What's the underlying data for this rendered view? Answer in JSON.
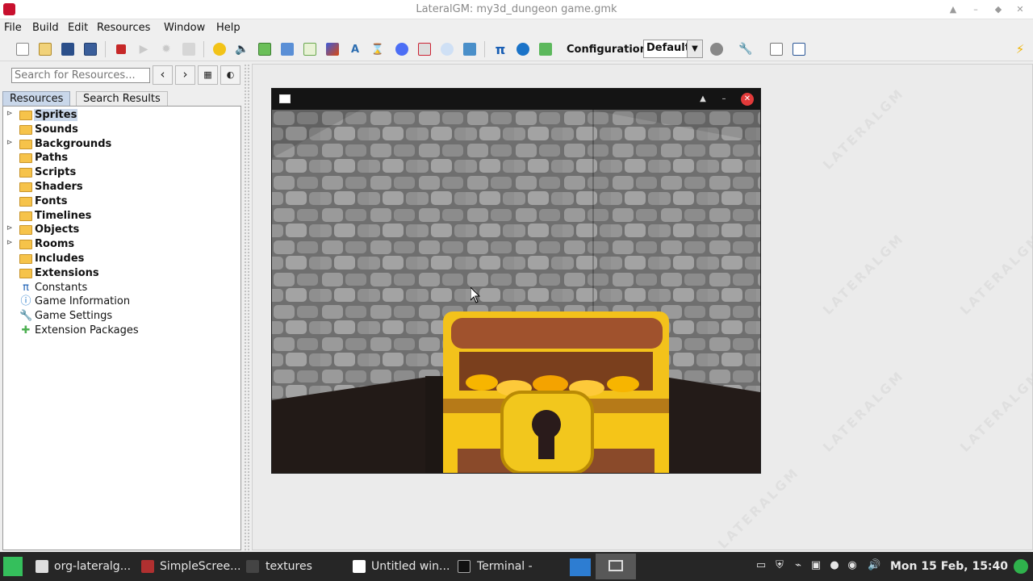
{
  "window": {
    "title": "LateralGM: my3d_dungeon game.gmk"
  },
  "menu": [
    "File",
    "Build",
    "Edit",
    "Resources",
    "Window",
    "Help"
  ],
  "toolbar": {
    "config_label": "Configuration:",
    "config_value": "Default"
  },
  "search": {
    "placeholder": "Search for Resources..."
  },
  "tabs": {
    "resources": "Resources",
    "search_results": "Search Results"
  },
  "tree": [
    {
      "label": "Sprites",
      "kind": "folder",
      "expandable": true,
      "bold": true,
      "selected": true
    },
    {
      "label": "Sounds",
      "kind": "folder",
      "expandable": false,
      "bold": true
    },
    {
      "label": "Backgrounds",
      "kind": "folder",
      "expandable": true,
      "bold": true
    },
    {
      "label": "Paths",
      "kind": "folder",
      "expandable": false,
      "bold": true
    },
    {
      "label": "Scripts",
      "kind": "folder",
      "expandable": false,
      "bold": true
    },
    {
      "label": "Shaders",
      "kind": "folder",
      "expandable": false,
      "bold": true
    },
    {
      "label": "Fonts",
      "kind": "folder",
      "expandable": false,
      "bold": true
    },
    {
      "label": "Timelines",
      "kind": "folder",
      "expandable": false,
      "bold": true
    },
    {
      "label": "Objects",
      "kind": "folder",
      "expandable": true,
      "bold": true
    },
    {
      "label": "Rooms",
      "kind": "folder",
      "expandable": true,
      "bold": true
    },
    {
      "label": "Includes",
      "kind": "folder",
      "expandable": false,
      "bold": true
    },
    {
      "label": "Extensions",
      "kind": "folder",
      "expandable": false,
      "bold": true
    },
    {
      "label": "Constants",
      "kind": "pi-icon",
      "bold": false
    },
    {
      "label": "Game Information",
      "kind": "info-icon",
      "bold": false
    },
    {
      "label": "Game Settings",
      "kind": "wrench-icon",
      "bold": false
    },
    {
      "label": "Extension Packages",
      "kind": "puzzle-icon",
      "bold": false
    }
  ],
  "taskbar": {
    "items": [
      "org-lateralg...",
      "SimpleScree...",
      "textures",
      "Untitled win...",
      "Terminal -"
    ],
    "clock": "Mon 15 Feb, 15:40"
  },
  "colors": {
    "selection": "#c9d7ea",
    "folder": "#f6c34a",
    "taskbar": "#262626",
    "close_button": "#e23a3a"
  }
}
